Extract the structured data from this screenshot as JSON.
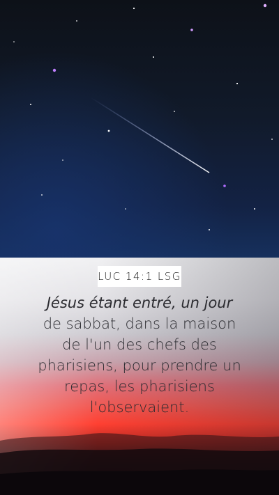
{
  "reference": "LUC 14:1 LSG",
  "verse_lines": [
    "Jésus étant entré, un jour",
    "de sabbat, dans la maison",
    "de l'un des chefs des",
    "pharisiens, pour prendre un",
    "repas, les pharisiens",
    "l'observaient."
  ],
  "colors": {
    "sky_top": "#0d1118",
    "sky_bottom": "#16305d",
    "sunset_red": "#ff4032",
    "star_violet": "#b37cff"
  },
  "icons": [
    "shooting-star",
    "star-field",
    "cloud-silhouette"
  ]
}
